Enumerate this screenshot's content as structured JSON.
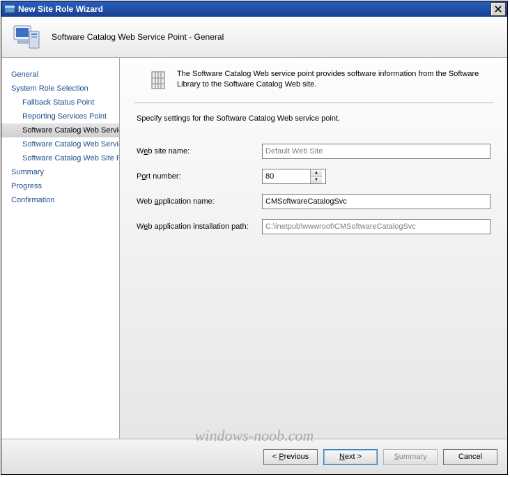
{
  "window": {
    "title": "New Site Role Wizard"
  },
  "header": {
    "text": "Software Catalog Web Service Point - General"
  },
  "sidebar": {
    "items": [
      {
        "label": "General",
        "sub": false,
        "selected": false
      },
      {
        "label": "System Role Selection",
        "sub": false,
        "selected": false
      },
      {
        "label": "Fallback Status Point",
        "sub": true,
        "selected": false
      },
      {
        "label": "Reporting Services Point",
        "sub": true,
        "selected": false
      },
      {
        "label": "Software Catalog Web Service Point",
        "sub": true,
        "selected": true
      },
      {
        "label": "Software Catalog Web Service Point",
        "sub": true,
        "selected": false
      },
      {
        "label": "Software Catalog Web Site Point",
        "sub": true,
        "selected": false
      },
      {
        "label": "Summary",
        "sub": false,
        "selected": false
      },
      {
        "label": "Progress",
        "sub": false,
        "selected": false
      },
      {
        "label": "Confirmation",
        "sub": false,
        "selected": false
      }
    ]
  },
  "content": {
    "description": "The Software Catalog Web service point provides software information from the Software Library to the Software Catalog Web site.",
    "instruction": "Specify settings for the Software Catalog Web service point.",
    "fields": {
      "website_label_pre": "W",
      "website_label_u": "e",
      "website_label_post": "b site name:",
      "website_value": "Default Web Site",
      "port_label_pre": "P",
      "port_label_u": "o",
      "port_label_post": "rt number:",
      "port_value": "80",
      "appname_label_pre": "Web ",
      "appname_label_u": "a",
      "appname_label_post": "pplication name:",
      "appname_value": "CMSoftwareCatalogSvc",
      "path_label_pre": "W",
      "path_label_u": "e",
      "path_label_post": "b application installation path:",
      "path_value": "C:\\inetpub\\wwwroot\\CMSoftwareCatalogSvc"
    }
  },
  "footer": {
    "previous_pre": "< ",
    "previous_u": "P",
    "previous_post": "revious",
    "next_pre": "",
    "next_u": "N",
    "next_post": "ext >",
    "summary_pre": "",
    "summary_u": "S",
    "summary_post": "ummary",
    "cancel": "Cancel"
  },
  "watermark": "windows-noob.com"
}
